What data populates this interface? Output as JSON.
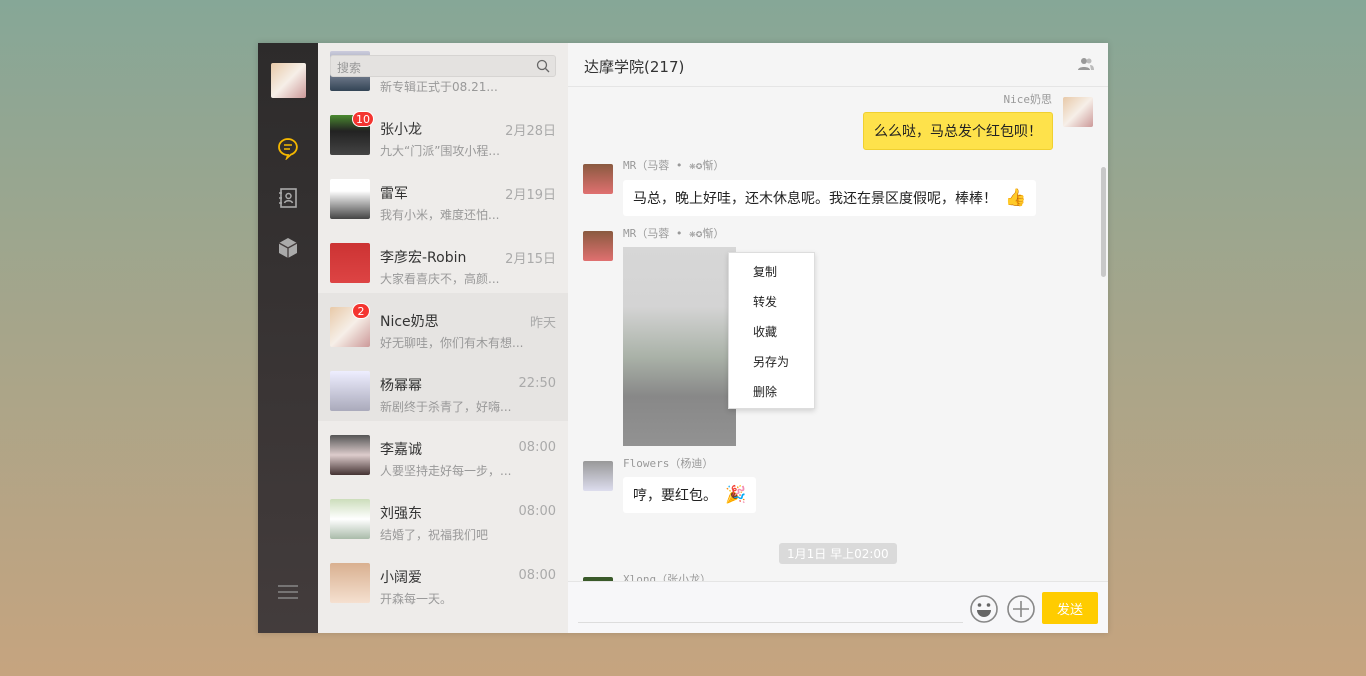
{
  "search": {
    "placeholder": "搜索"
  },
  "chats": [
    {
      "name": "",
      "time": "",
      "preview": "新专辑正式于08.21...",
      "badge": ""
    },
    {
      "name": "张小龙",
      "time": "2月28日",
      "preview": "九大“门派”围攻小程...",
      "badge": "10"
    },
    {
      "name": "雷军",
      "time": "2月19日",
      "preview": "我有小米，难度还怕...",
      "badge": ""
    },
    {
      "name": "李彦宏-Robin",
      "time": "2月15日",
      "preview": "大家看喜庆不，高颜...",
      "badge": ""
    },
    {
      "name": "Nice奶思",
      "time": "昨天",
      "preview": "好无聊哇，你们有木有想...",
      "badge": "2"
    },
    {
      "name": "杨幂幂",
      "time": "22:50",
      "preview": "新剧终于杀青了，好嗨...",
      "badge": ""
    },
    {
      "name": "李嘉诚",
      "time": "08:00",
      "preview": "人要坚持走好每一步，...",
      "badge": ""
    },
    {
      "name": "刘强东",
      "time": "08:00",
      "preview": "结婚了，祝福我们吧",
      "badge": ""
    },
    {
      "name": "小阔爱",
      "time": "08:00",
      "preview": "开森每一天。",
      "badge": ""
    }
  ],
  "chat": {
    "title": "达摩学院(217)",
    "messages": [
      {
        "sender": "Nice奶思",
        "text": "么么哒，马总发个红包呗！"
      },
      {
        "sender": "MR（马蓉 • ❋✪惭）",
        "text": "马总，晚上好哇，还木休息呢。我还在景区度假呢，棒棒！",
        "emoji": "👍"
      },
      {
        "sender": "MR（马蓉 • ❋✪惭）"
      },
      {
        "sender": "Flowers（杨迪）",
        "text": "哼，要红包。",
        "emoji": "🎉"
      },
      {
        "sender": "Xlong（张小龙）"
      }
    ],
    "timestamp": "1月1日 早上02:00",
    "context_menu": [
      "复制",
      "转发",
      "收藏",
      "另存为",
      "删除"
    ],
    "send_label": "发送"
  },
  "colors": {
    "accent": "#ffcc00",
    "bubble_me": "#fee24b",
    "badge": "#f43530"
  }
}
